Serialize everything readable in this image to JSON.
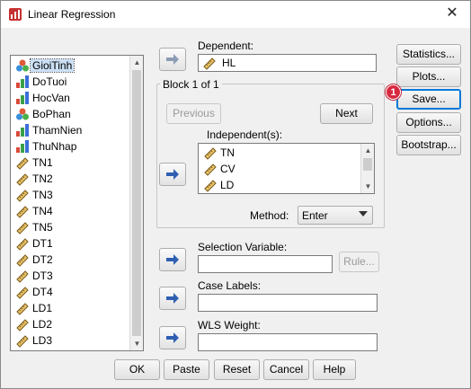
{
  "window": {
    "title": "Linear Regression",
    "close_glyph": "✕"
  },
  "variables": [
    {
      "label": "GioiTinh",
      "icon": "nominal-icon"
    },
    {
      "label": "DoTuoi",
      "icon": "ordinal-icon"
    },
    {
      "label": "HocVan",
      "icon": "ordinal-icon"
    },
    {
      "label": "BoPhan",
      "icon": "nominal-icon"
    },
    {
      "label": "ThamNien",
      "icon": "ordinal-icon"
    },
    {
      "label": "ThuNhap",
      "icon": "ordinal-icon"
    },
    {
      "label": "TN1",
      "icon": "scale-icon"
    },
    {
      "label": "TN2",
      "icon": "scale-icon"
    },
    {
      "label": "TN3",
      "icon": "scale-icon"
    },
    {
      "label": "TN4",
      "icon": "scale-icon"
    },
    {
      "label": "TN5",
      "icon": "scale-icon"
    },
    {
      "label": "DT1",
      "icon": "scale-icon"
    },
    {
      "label": "DT2",
      "icon": "scale-icon"
    },
    {
      "label": "DT3",
      "icon": "scale-icon"
    },
    {
      "label": "DT4",
      "icon": "scale-icon"
    },
    {
      "label": "LD1",
      "icon": "scale-icon"
    },
    {
      "label": "LD2",
      "icon": "scale-icon"
    },
    {
      "label": "LD3",
      "icon": "scale-icon"
    }
  ],
  "dependent": {
    "label": "Dependent:",
    "value": "HL"
  },
  "block": {
    "label": "Block 1 of 1",
    "previous": "Previous",
    "next": "Next"
  },
  "independents": {
    "label": "Independent(s):",
    "items": [
      "TN",
      "CV",
      "LD"
    ]
  },
  "method": {
    "label": "Method:",
    "value": "Enter"
  },
  "selection_variable": {
    "label": "Selection Variable:",
    "rule_button": "Rule..."
  },
  "case_labels": {
    "label": "Case Labels:"
  },
  "wls_weight": {
    "label": "WLS Weight:"
  },
  "side_buttons": {
    "statistics": "Statistics...",
    "plots": "Plots...",
    "save": "Save...",
    "options": "Options...",
    "bootstrap": "Bootstrap..."
  },
  "annotation_badge": "1",
  "bottom_buttons": {
    "ok": "OK",
    "paste": "Paste",
    "reset": "Reset",
    "cancel": "Cancel",
    "help": "Help"
  },
  "colors": {
    "selection": "#cce0f5",
    "badge": "#d8283f",
    "arrow_blue": "#2f5fb3",
    "ruler": "#c89a3a"
  }
}
